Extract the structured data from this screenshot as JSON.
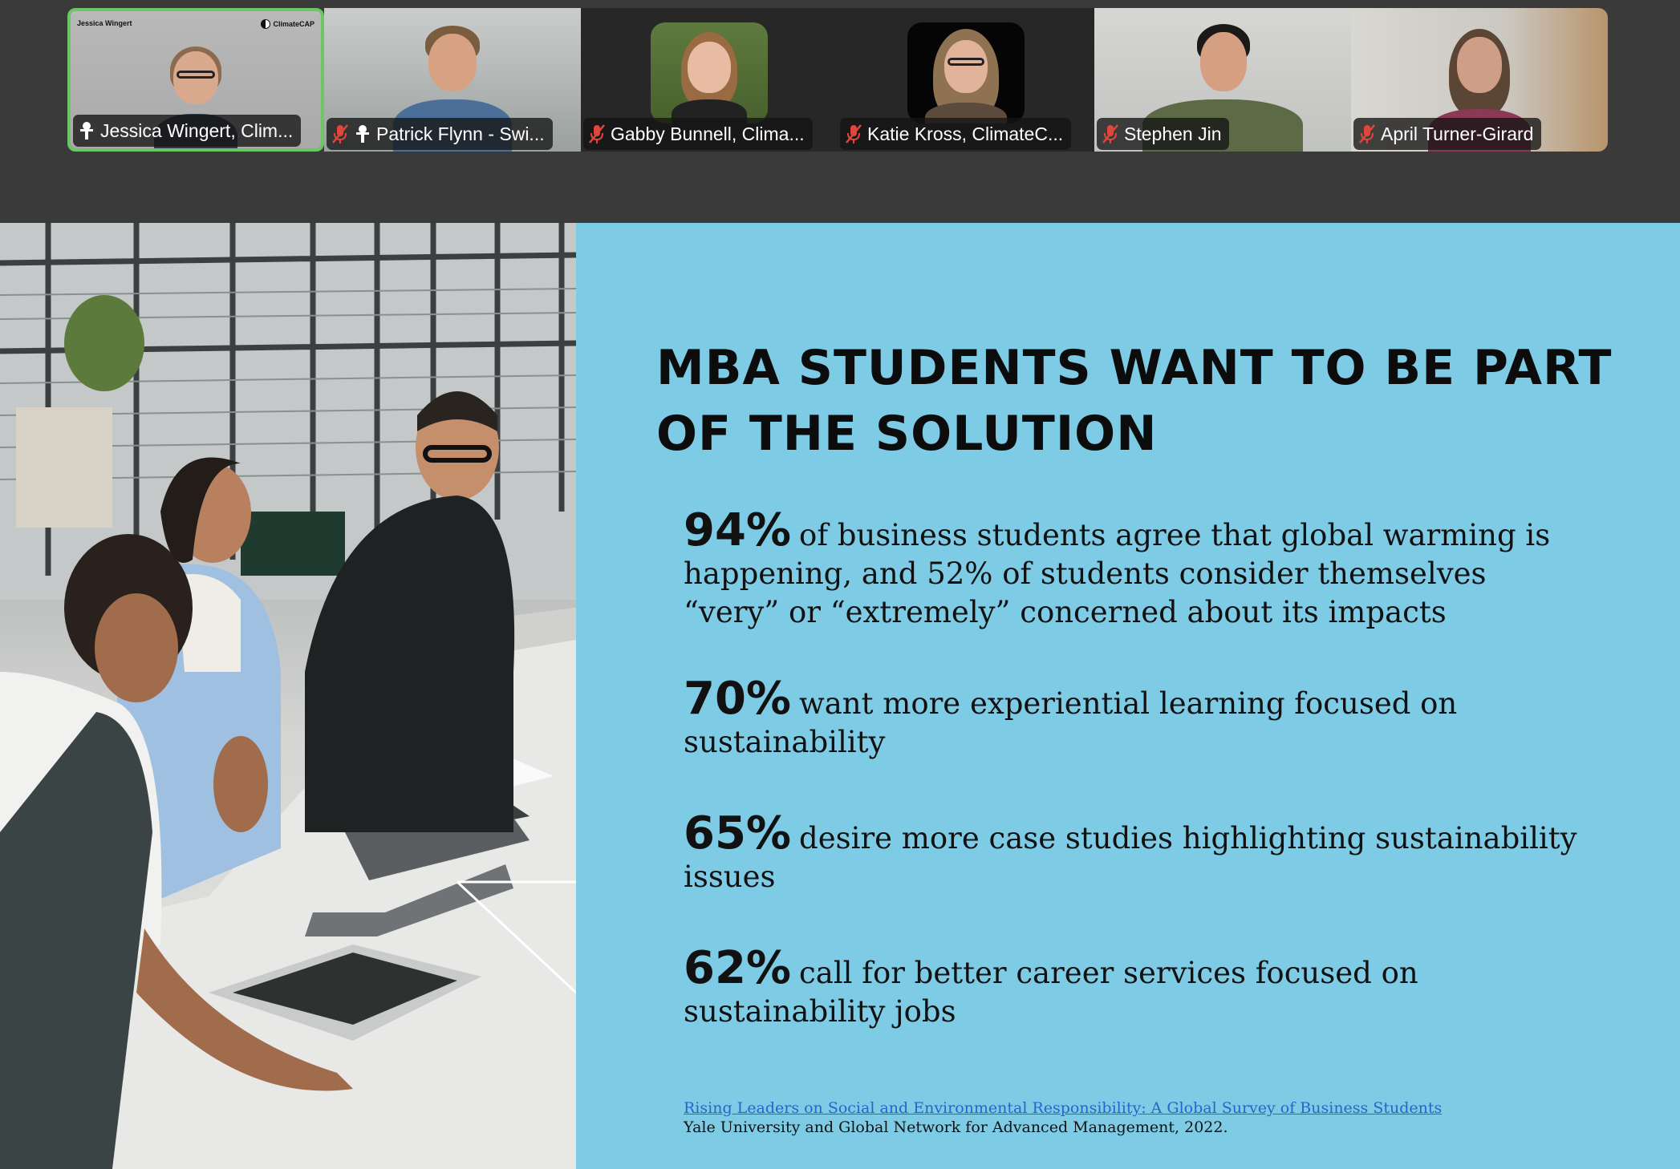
{
  "participants": [
    {
      "name": "Jessica Wingert, Clim...",
      "active": true,
      "pinned": true,
      "muted": false,
      "tile_title": "Jessica Wingert",
      "tile_logo": "ClimateCAP",
      "icon": "pin-icon"
    },
    {
      "name": "Patrick Flynn - Swi...",
      "active": false,
      "pinned": true,
      "muted": true,
      "icon": "mic-muted-icon"
    },
    {
      "name": "Gabby Bunnell, Clima...",
      "active": false,
      "pinned": false,
      "muted": true,
      "icon": "mic-muted-icon"
    },
    {
      "name": "Katie Kross, ClimateC...",
      "active": false,
      "pinned": false,
      "muted": true,
      "icon": "mic-muted-icon"
    },
    {
      "name": "Stephen Jin",
      "active": false,
      "pinned": false,
      "muted": true,
      "icon": "mic-muted-icon"
    },
    {
      "name": "April Turner-Girard",
      "active": false,
      "pinned": false,
      "muted": true,
      "icon": "mic-muted-icon"
    }
  ],
  "slide": {
    "title": "MBA STUDENTS WANT TO BE PART OF THE SOLUTION",
    "stats": [
      {
        "percent": "94%",
        "text": "of business students agree that global warming is happening, and 52% of students consider themselves “very” or “extremely” concerned about its impacts"
      },
      {
        "percent": "70%",
        "text": "want more experiential learning focused on sustainability"
      },
      {
        "percent": "65%",
        "text": "desire more case studies highlighting sustainability issues"
      },
      {
        "percent": "62%",
        "text": "call for better career services focused on sustainability jobs"
      }
    ],
    "source_link": "Rising Leaders on Social and Environmental Responsibility: A Global Survey of Business Students",
    "source_text": "Yale University and Global Network for Advanced Management, 2022."
  },
  "colors": {
    "slide_background": "#7ecbe6",
    "active_speaker_border": "#6ac763",
    "muted_icon": "#e0463c",
    "strip_background": "#3a3a3a"
  }
}
